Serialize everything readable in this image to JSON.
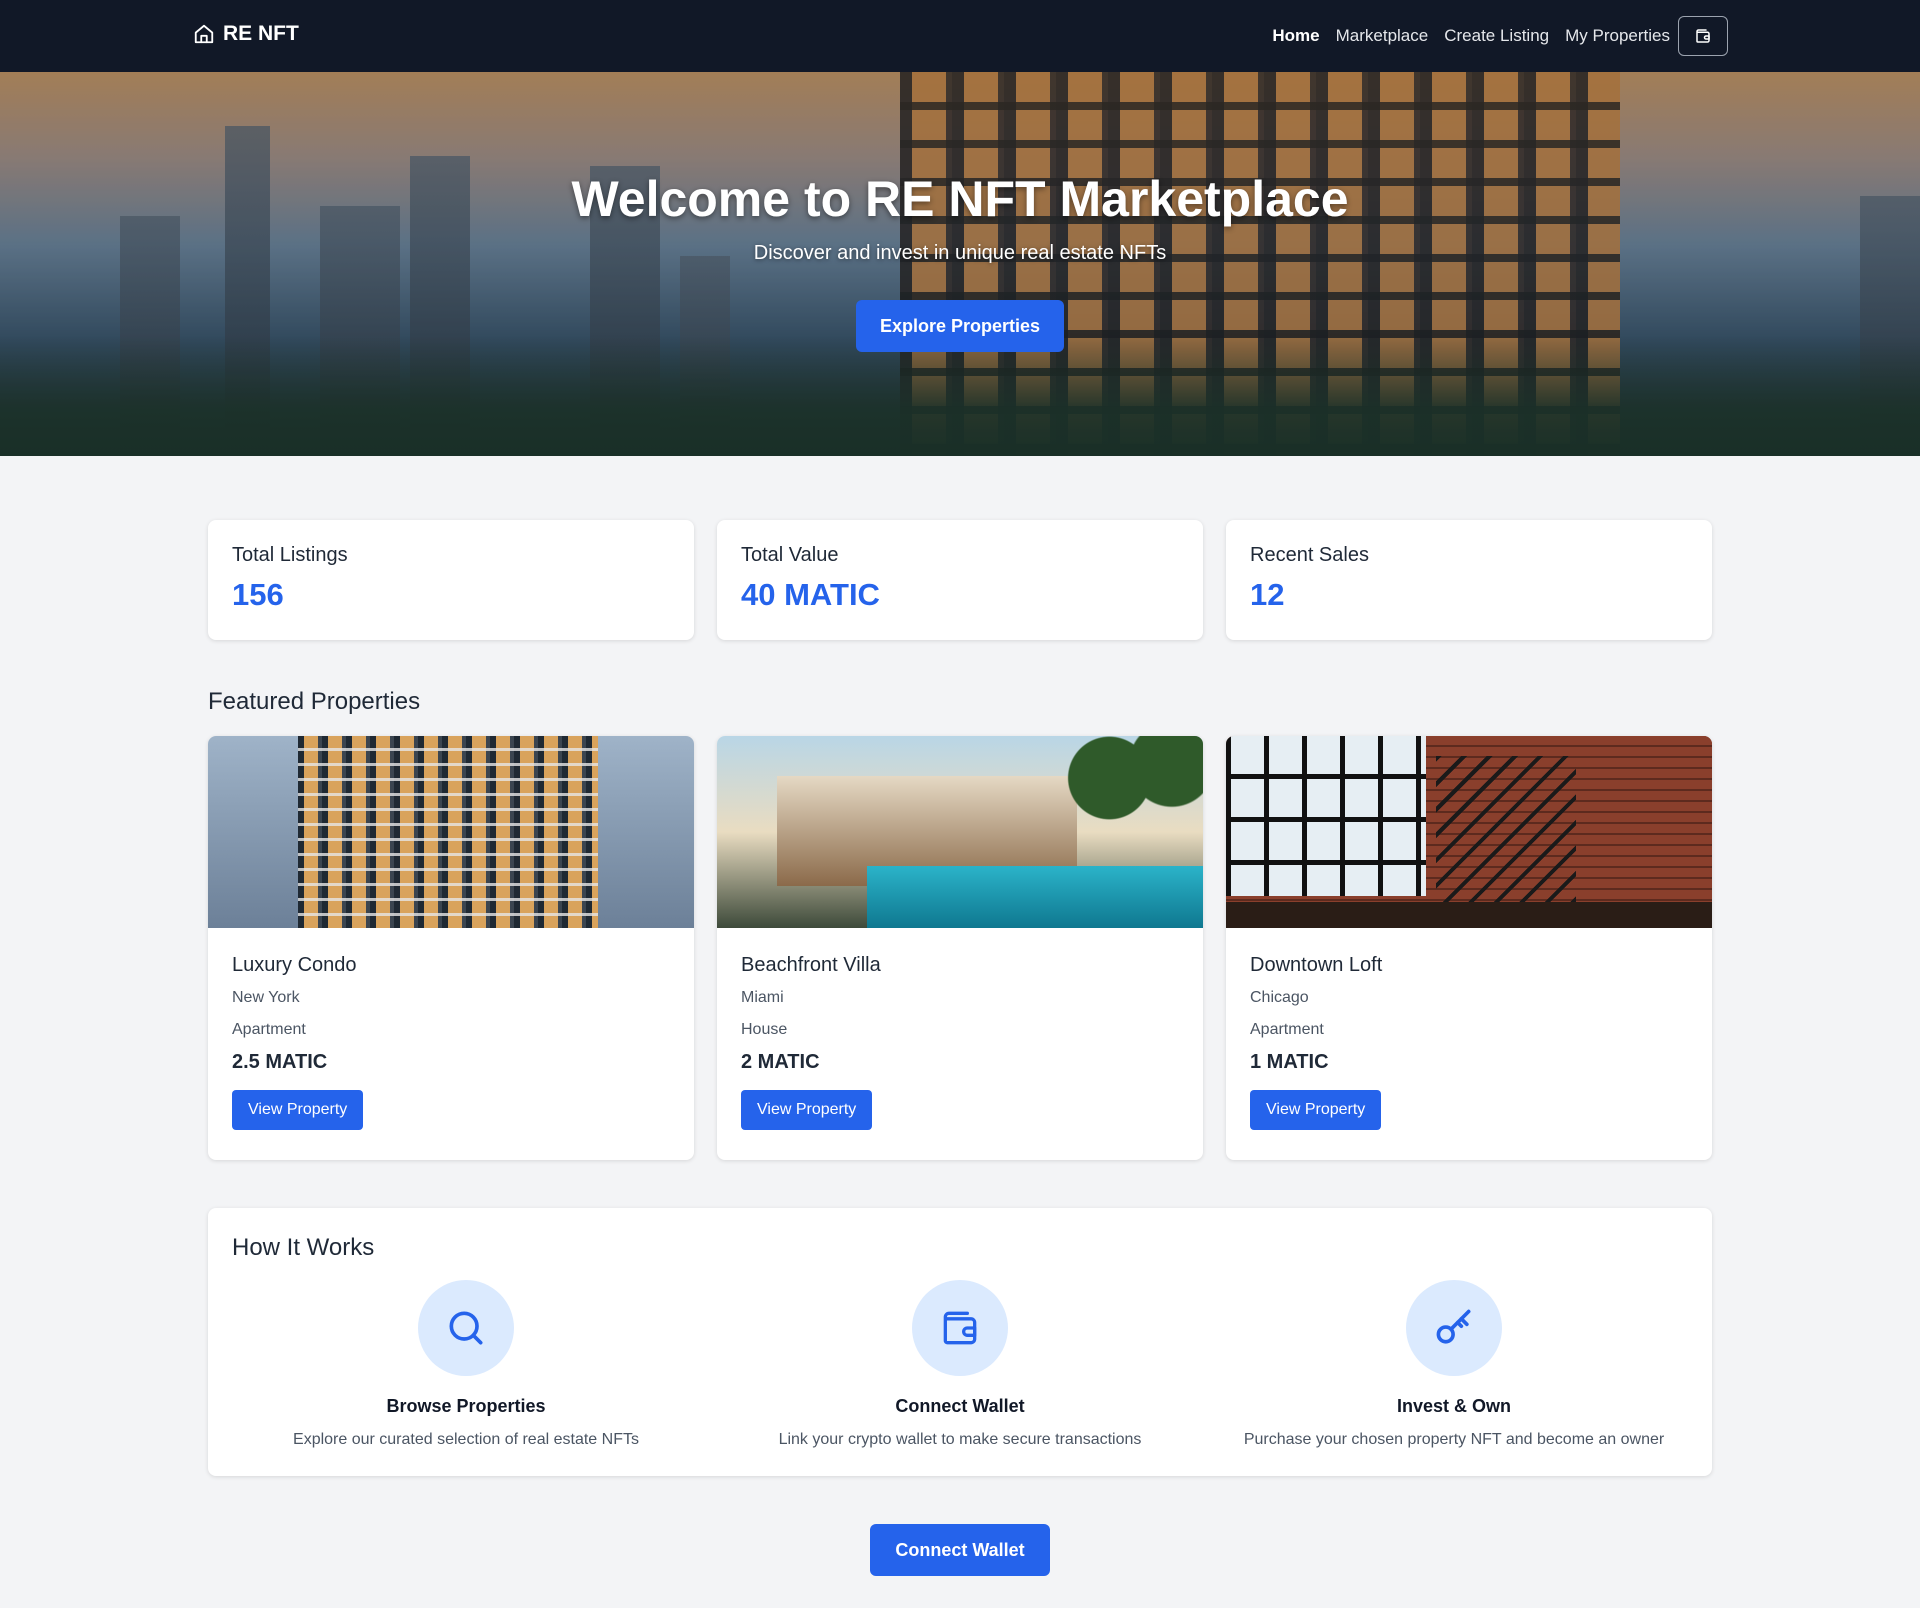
{
  "nav": {
    "brand": "RE NFT",
    "links": [
      "Home",
      "Marketplace",
      "Create Listing",
      "My Properties"
    ]
  },
  "hero": {
    "title": "Welcome to RE NFT Marketplace",
    "subtitle": "Discover and invest in unique real estate NFTs",
    "button": "Explore Properties"
  },
  "stats": [
    {
      "label": "Total Listings",
      "value": "156"
    },
    {
      "label": "Total Value",
      "value": "40 MATIC"
    },
    {
      "label": "Recent Sales",
      "value": "12"
    }
  ],
  "featured": {
    "title": "Featured Properties",
    "properties": [
      {
        "name": "Luxury Condo",
        "city": "New York",
        "type": "Apartment",
        "price": "2.5 MATIC",
        "button": "View Property"
      },
      {
        "name": "Beachfront Villa",
        "city": "Miami",
        "type": "House",
        "price": "2 MATIC",
        "button": "View Property"
      },
      {
        "name": "Downtown Loft",
        "city": "Chicago",
        "type": "Apartment",
        "price": "1 MATIC",
        "button": "View Property"
      }
    ]
  },
  "how_it_works": {
    "title": "How It Works",
    "steps": [
      {
        "title": "Browse Properties",
        "desc": "Explore our curated selection of real estate NFTs",
        "icon": "search-icon"
      },
      {
        "title": "Connect Wallet",
        "desc": "Link your crypto wallet to make secure transactions",
        "icon": "wallet-icon"
      },
      {
        "title": "Invest & Own",
        "desc": "Purchase your chosen property NFT and become an owner",
        "icon": "key-icon"
      }
    ]
  },
  "connect_button": "Connect Wallet",
  "colors": {
    "accent": "#2563eb",
    "nav_bg": "#111827",
    "icon_bg": "#dbeafe"
  }
}
